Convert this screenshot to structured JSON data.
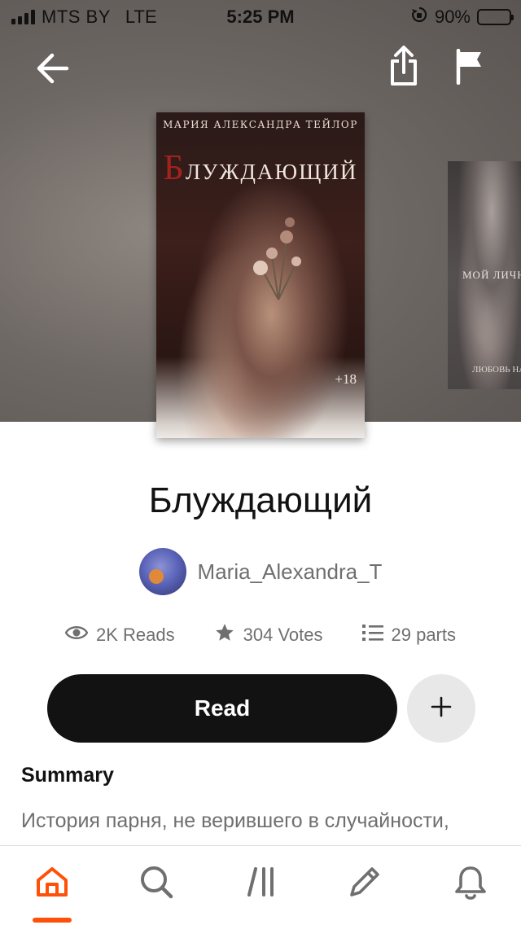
{
  "status_bar": {
    "carrier": "MTS BY",
    "network": "LTE",
    "time": "5:25 PM",
    "battery_percent": "90%",
    "battery_level": 0.9
  },
  "header": {
    "back_icon": "arrow-left-icon",
    "share_icon": "share-icon",
    "report_icon": "flag-icon"
  },
  "cover": {
    "author": "МАРИЯ АЛЕКСАНДРА ТЕЙЛОР",
    "title_initial": "Б",
    "title_rest": "ЛУЖДАЮЩИЙ",
    "age_rating": "+18"
  },
  "next_cover": {
    "title": "МОЙ ЛИЧНЫЙ",
    "subtitle": "ЛЮБОВЬ НА ПР"
  },
  "story": {
    "title": "Блуждающий",
    "author": "Maria_Alexandra_T",
    "reads": "2K Reads",
    "votes": "304 Votes",
    "parts": "29 parts",
    "read_label": "Read",
    "summary_heading": "Summary",
    "summary_text": "История парня, не верившего в случайности,"
  },
  "tab_bar": {
    "tabs": [
      {
        "name": "home",
        "icon": "home-icon",
        "active": true
      },
      {
        "name": "search",
        "icon": "search-icon",
        "active": false
      },
      {
        "name": "library",
        "icon": "library-icon",
        "active": false
      },
      {
        "name": "write",
        "icon": "pencil-icon",
        "active": false
      },
      {
        "name": "notifications",
        "icon": "bell-icon",
        "active": false
      }
    ]
  },
  "colors": {
    "accent": "#ff500a",
    "primary_button": "#121212",
    "secondary_text": "#6f6f6f"
  }
}
